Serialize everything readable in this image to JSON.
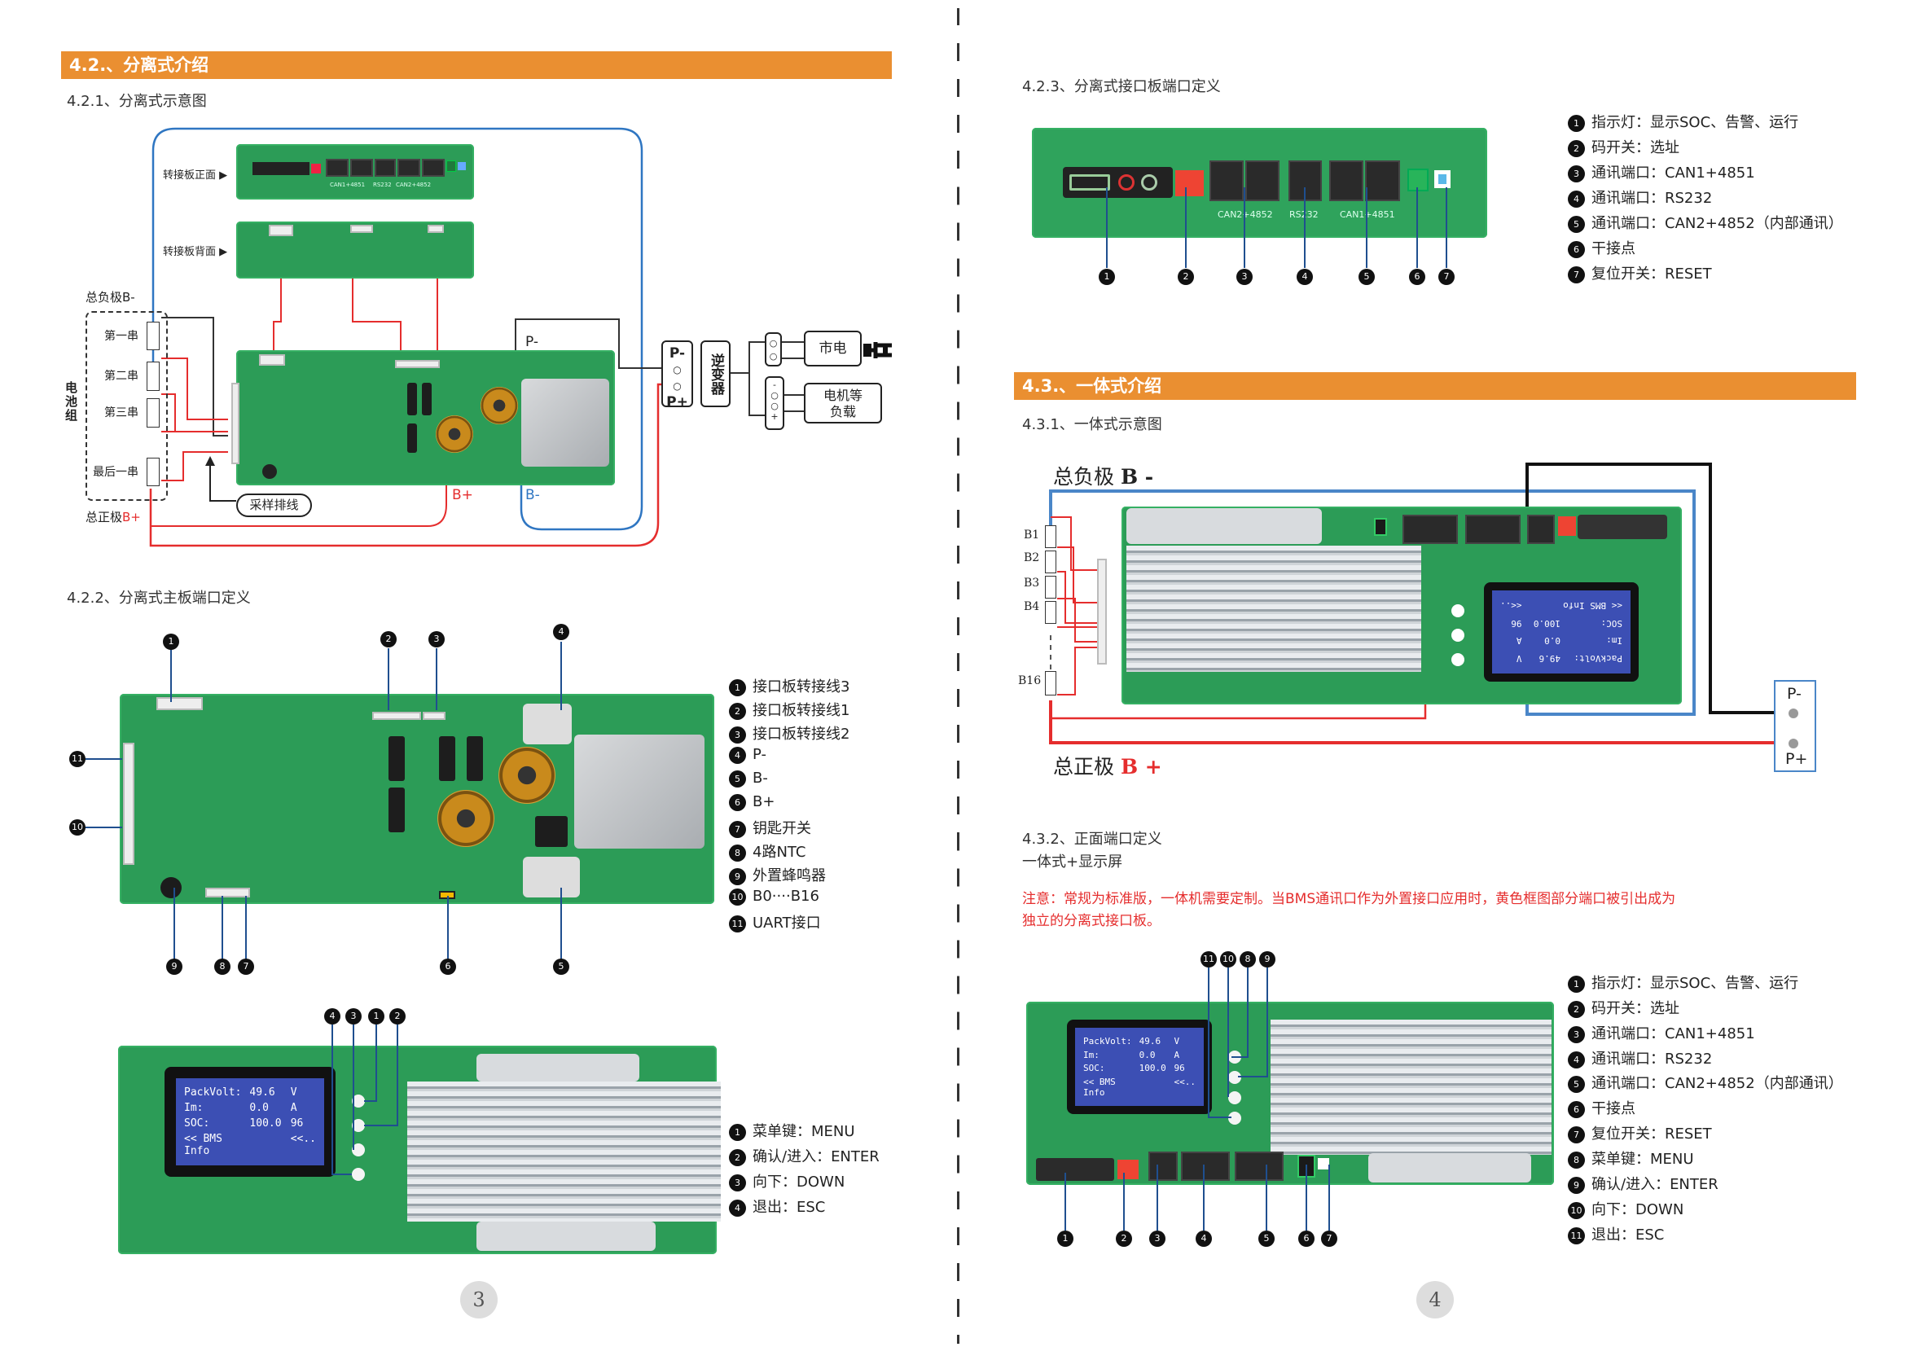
{
  "left_page": {
    "section_title": "4.2.、分离式介绍",
    "sub1": "4.2.1、分离式示意图",
    "diagram1": {
      "front_label": "转接板正面 ▶",
      "back_label": "转接板背面 ▶",
      "front_ports": [
        "CAN1+4851",
        "RS232",
        "CAN2+4852"
      ],
      "total_negative": "总负极B-",
      "total_positive_prefix": "总正极",
      "total_positive_suffix": "B+",
      "battery_pack": "电池组",
      "cells": [
        "第一串",
        "第二串",
        "第三串",
        "最后一串"
      ],
      "sampling_cable": "采样排线",
      "p_minus": "P-",
      "b_plus": "B+",
      "b_minus": "B-",
      "pp_box": [
        "P-",
        "P+"
      ],
      "inverter": "逆变器",
      "grid": "市电",
      "load": "电机等负载",
      "load_signs": [
        "-",
        "+"
      ]
    },
    "sub2": "4.2.2、分离式主板端口定义",
    "main_board_legend": [
      {
        "num": "1",
        "text": "接口板转接线3"
      },
      {
        "num": "2",
        "text": "接口板转接线1"
      },
      {
        "num": "3",
        "text": "接口板转接线2"
      },
      {
        "num": "4",
        "text": "P-"
      },
      {
        "num": "5",
        "text": "B-"
      },
      {
        "num": "6",
        "text": "B+"
      },
      {
        "num": "7",
        "text": "钥匙开关"
      },
      {
        "num": "8",
        "text": "4路NTC"
      },
      {
        "num": "9",
        "text": "外置蜂鸣器"
      },
      {
        "num": "10",
        "text": "B0····B16"
      },
      {
        "num": "11",
        "text": "UART接口"
      }
    ],
    "lcd": {
      "rows": [
        [
          "PackVolt:",
          "49.6",
          "V"
        ],
        [
          "Im:",
          "0.0",
          "A"
        ],
        [
          "SOC:",
          "100.0",
          "96"
        ],
        [
          "<< BMS Info",
          "",
          "<<.."
        ]
      ]
    },
    "display_legend": [
      {
        "num": "1",
        "text": "菜单键：MENU"
      },
      {
        "num": "2",
        "text": "确认/进入：ENTER"
      },
      {
        "num": "3",
        "text": "向下：DOWN"
      },
      {
        "num": "4",
        "text": "退出：ESC"
      }
    ],
    "page_number": "3"
  },
  "right_page": {
    "sub3": "4.2.3、分离式接口板端口定义",
    "interface_ports": [
      "CAN2+4852",
      "RS232",
      "CAN1+4851"
    ],
    "interface_legend": [
      {
        "num": "1",
        "text": "指示灯：显示SOC、告警、运行"
      },
      {
        "num": "2",
        "text": "码开关：选址"
      },
      {
        "num": "3",
        "text": "通讯端口：CAN1+4851"
      },
      {
        "num": "4",
        "text": "通讯端口：RS232"
      },
      {
        "num": "5",
        "text": "通讯端口：CAN2+4852（内部通讯）"
      },
      {
        "num": "6",
        "text": "干接点"
      },
      {
        "num": "7",
        "text": "复位开关：RESET"
      }
    ],
    "section_title": "4.3.、一体式介绍",
    "sub1": "4.3.1、一体式示意图",
    "diagram2": {
      "total_negative_prefix": "总负极",
      "total_negative_suffix": "B -",
      "total_positive_prefix": "总正极",
      "total_positive_suffix": "B +",
      "cells": [
        "B1",
        "B2",
        "B3",
        "B4",
        "B16"
      ],
      "p_minus": "P-",
      "p_plus": "P+"
    },
    "sub2": "4.3.2、正面端口定义",
    "sub2_caption": "一体式+显示屏",
    "notice": [
      "注意：常规为标准版，一体机需要定制。当BMS通讯口作为外置接口应用时，黄色框图部分端口被引出成为",
      "独立的分离式接口板。"
    ],
    "front_legend": [
      {
        "num": "1",
        "text": "指示灯：显示SOC、告警、运行"
      },
      {
        "num": "2",
        "text": "码开关：选址"
      },
      {
        "num": "3",
        "text": "通讯端口：CAN1+4851"
      },
      {
        "num": "4",
        "text": "通讯端口：RS232"
      },
      {
        "num": "5",
        "text": "通讯端口：CAN2+4852（内部通讯）"
      },
      {
        "num": "6",
        "text": "干接点"
      },
      {
        "num": "7",
        "text": "复位开关：RESET"
      },
      {
        "num": "8",
        "text": "菜单键：MENU"
      },
      {
        "num": "9",
        "text": "确认/进入：ENTER"
      },
      {
        "num": "10",
        "text": "向下：DOWN"
      },
      {
        "num": "11",
        "text": "退出：ESC"
      }
    ],
    "page_number": "4"
  },
  "colors": {
    "section_bar": "#ea8f31",
    "pcb": "#2c9c57",
    "wire_red": "#e52d2d",
    "wire_blue": "#2f76c2",
    "lcd": "#3c4fb4",
    "notice": "#e52d2d"
  }
}
